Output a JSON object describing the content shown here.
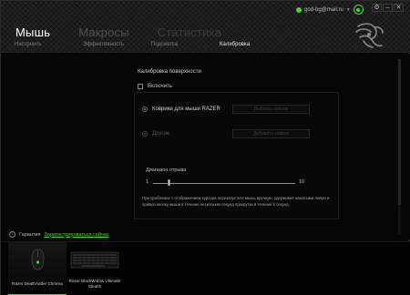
{
  "account": {
    "email": "god-bg@mail.ru"
  },
  "window_controls": {
    "settings": "⚙",
    "minimize": "–",
    "close": "✕"
  },
  "main_tabs": [
    {
      "label": "Мышь",
      "active": true
    },
    {
      "label": "Макросы",
      "active": false
    },
    {
      "label": "Статистика",
      "active": false
    }
  ],
  "sub_tabs": [
    {
      "label": "Настроить",
      "active": false
    },
    {
      "label": "Эффективность",
      "active": false
    },
    {
      "label": "Подсветка",
      "active": false
    },
    {
      "label": "Калибровка",
      "active": true
    }
  ],
  "calibration": {
    "title": "Калибровка поверхности",
    "enable_label": "Включить",
    "enabled": false,
    "options": [
      {
        "label": "Коврики для мыши RAZER",
        "button": "Выбрать коврик",
        "enabled": true
      },
      {
        "label": "Другие",
        "button": "Добавить коврик",
        "enabled": false
      }
    ],
    "liftoff": {
      "label": "Диапазон отрыва",
      "min": "1",
      "max": "10",
      "value": 2
    },
    "help_text": "При проблемах с отображением курсора перезапустите мышь вручную, удерживая нажатыми левую и правую кнопку мыши в течение нескольких секунд прокрутки в течение 5 секунд."
  },
  "warranty": {
    "label": "Гарантия",
    "link": "Зарегистрироваться сейчас"
  },
  "devices": [
    {
      "name": "Razer DeathAdder Chroma",
      "selected": true
    },
    {
      "name": "Razer BlackWidow Ultimate Stealth",
      "selected": false
    }
  ],
  "colors": {
    "accent": "#44d62c",
    "background": "#050505"
  },
  "icons": [
    "online-dot-icon",
    "razer-logo-icon",
    "gear-icon",
    "minimize-icon",
    "close-icon",
    "info-icon",
    "mouse-device-icon",
    "keyboard-device-icon"
  ]
}
